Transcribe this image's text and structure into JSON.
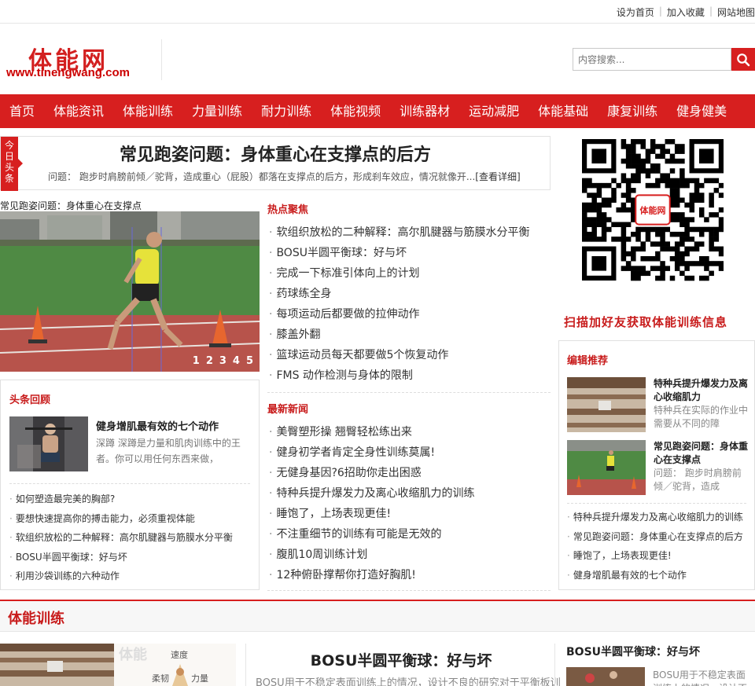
{
  "topbar": {
    "links": [
      "设为首页",
      "加入收藏",
      "网站地图"
    ]
  },
  "logo": {
    "name": "体能网",
    "url": "www.tinengwang.com"
  },
  "search": {
    "placeholder": "内容搜索..."
  },
  "nav": [
    "首页",
    "体能资讯",
    "体能训练",
    "力量训练",
    "耐力训练",
    "体能视频",
    "训练器材",
    "运动减肥",
    "体能基础",
    "康复训练",
    "健身健美"
  ],
  "headline": {
    "tag": "今日头条",
    "title": "常见跑姿问题：身体重心在支撑点的后方",
    "desc": "问题：  跑步时肩膀前倾／驼背，造成重心（屁股）都落在支撑点的后方，形成刹车效应，情况就像开...",
    "more": "[查看详细]"
  },
  "slideshow": {
    "caption": "常见跑姿问题：身体重心在支撑点",
    "pages": [
      "1",
      "2",
      "3",
      "4",
      "5"
    ]
  },
  "review": {
    "title": "头条回顾",
    "feature": {
      "title": "健身增肌最有效的七个动作",
      "desc": "深蹲  深蹲是力量和肌肉训练中的王者。你可以用任何东西来做，"
    },
    "items": [
      "如何塑造最完美的胸部?",
      "要想快速提高你的搏击能力，必须重视体能",
      "软组织放松的二种解释：高尔肌腱器与筋膜水分平衡",
      "BOSU半圆平衡球：好与坏",
      "利用沙袋训练的六种动作"
    ]
  },
  "hot": {
    "title": "热点聚焦",
    "items": [
      "软组织放松的二种解释：高尔肌腱器与筋膜水分平衡",
      "BOSU半圆平衡球：好与坏",
      "完成一下标准引体向上的计划",
      "药球练全身",
      "每项运动后都要做的拉伸动作",
      "膝盖外翻",
      "篮球运动员每天都要做5个恢复动作",
      "FMS 动作检测与身体的限制"
    ]
  },
  "latest": {
    "title": "最新新闻",
    "items": [
      "美臀塑形操 翘臀轻松练出来",
      "健身初学者肯定全身性训练莫属!",
      "无健身基因?6招助你走出困惑",
      "特种兵提升爆发力及离心收缩肌力的训练",
      "睡饱了，上场表现更佳!",
      "不注重细节的训练有可能是无效的",
      "腹肌10周训练计划",
      "12种俯卧撑帮你打造好胸肌!"
    ]
  },
  "qr": {
    "badge": "体能网",
    "caption": "扫描加好友获取体能训练信息"
  },
  "editor": {
    "title": "编辑推荐",
    "cards": [
      {
        "title": "特种兵提升爆发力及离心收缩肌力",
        "desc": "特种兵在实际的作业中需要从不同的障"
      },
      {
        "title": "常见跑姿问题：身体重心在支撑点",
        "desc": "问题：  跑步时肩膀前倾／驼背，造成"
      }
    ],
    "items": [
      "特种兵提升爆发力及离心收缩肌力的训练",
      "常见跑姿问题：身体重心在支撑点的后方",
      "睡饱了，上场表现更佳!",
      "健身增肌最有效的七个动作"
    ]
  },
  "section": {
    "title": "体能训练",
    "main_title": "BOSU半圆平衡球：好与坏",
    "main_desc": "BOSU用于不稳定表面训练上的情况，设计不良的研究对于平衡板训",
    "img_words": [
      "体能",
      "速度",
      "柔韧",
      "力量"
    ],
    "right_title": "BOSU半圆平衡球：好与坏",
    "right_desc": "BOSU用于不稳定表面训练上的情况，设计不"
  },
  "colors": {
    "brand": "#d71f1f",
    "title_red": "#c81c1c"
  }
}
